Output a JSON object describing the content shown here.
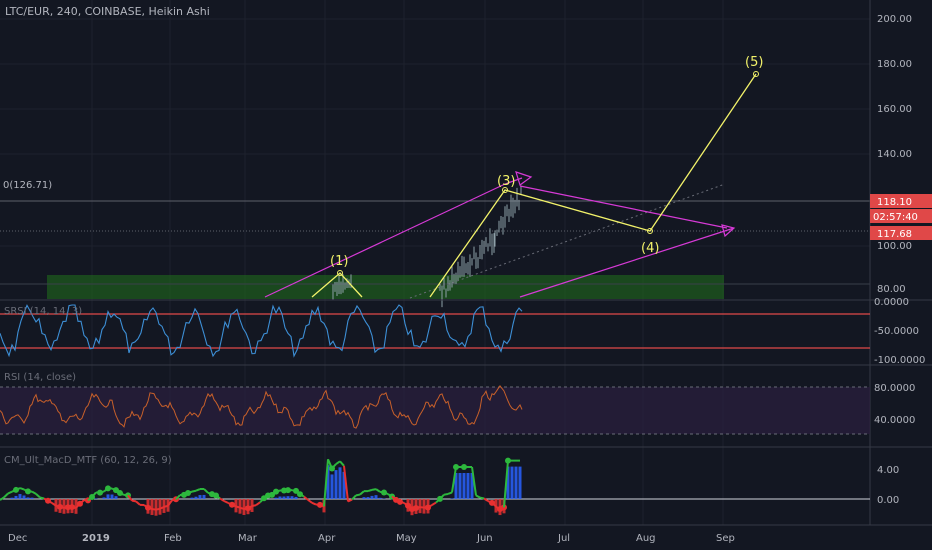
{
  "header": {
    "symbol_line": "LTC/EUR, 240, COINBASE, Heikin Ashi"
  },
  "colors": {
    "background": "#131722",
    "grid": "#2a2e39",
    "axis_text": "#b2b5be",
    "wave_line": "#f2f26a",
    "channel": "#d63ad6",
    "green_zone": "#1e5a1e",
    "price_candles": "#8ea0a8",
    "stoch_line": "#3d8fd6",
    "band_line": "#e04848",
    "rsi_line": "#c8602a",
    "rsi_band_fill": "#2a1f3d",
    "macd_up": "#2db83d",
    "macd_down": "#e83030",
    "hist_blue": "#2962ff"
  },
  "main_panel": {
    "fib_label": "0(126.71)",
    "price_ticks": [
      "200.00",
      "180.00",
      "160.00",
      "140.00",
      "100.00",
      "80.00"
    ],
    "badges": {
      "price_top": "118.10",
      "countdown": "02:57:40",
      "price_bottom": "117.68"
    },
    "wave_labels": [
      "(1)",
      "(3)",
      "(4)",
      "(5)"
    ]
  },
  "stoch_panel": {
    "title": "SRSI (14, 14, 3)",
    "ticks": [
      "0.0000",
      "-50.0000",
      "-100.0000"
    ]
  },
  "rsi_panel": {
    "title": "RSI (14, close)",
    "ticks": [
      "80.0000",
      "40.0000"
    ]
  },
  "macd_panel": {
    "title": "CM_Ult_MacD_MTF (60, 12, 26, 9)",
    "ticks": [
      "4.00",
      "0.00"
    ]
  },
  "time_axis": {
    "labels": [
      "Dec",
      "2019",
      "Feb",
      "Mar",
      "Apr",
      "May",
      "Jun",
      "Jul",
      "Aug",
      "Sep"
    ]
  },
  "chart_data": {
    "type": "line",
    "title": "LTC/EUR, 240, COINBASE, Heikin Ashi",
    "x_labels": [
      "Dec",
      "2019",
      "Feb",
      "Mar",
      "Apr",
      "May",
      "Jun",
      "Jul",
      "Aug",
      "Sep"
    ],
    "y_ticks": [
      80,
      100,
      140,
      160,
      180,
      200
    ],
    "last_price": 118.1,
    "fib_level": 126.71,
    "elliott_wave": [
      {
        "label": "(1)",
        "date": "2019-04-03",
        "price": 86
      },
      {
        "label": "(3)",
        "date": "2019-06-08",
        "price": 123
      },
      {
        "label": "(4)",
        "date": "2019-08-03",
        "price": 113
      },
      {
        "label": "(5)",
        "date": "2019-09-13",
        "price": 175
      }
    ],
    "green_zone_range": [
      76,
      86
    ],
    "indicators": [
      {
        "name": "SRSI (14, 14, 3)",
        "levels": [
          -20,
          -80
        ],
        "range": [
          -100,
          0
        ]
      },
      {
        "name": "RSI (14, close)",
        "levels": [
          80,
          40
        ]
      },
      {
        "name": "CM_Ult_MacD_MTF (60, 12, 26, 9)",
        "range": [
          -1,
          6
        ]
      }
    ]
  }
}
